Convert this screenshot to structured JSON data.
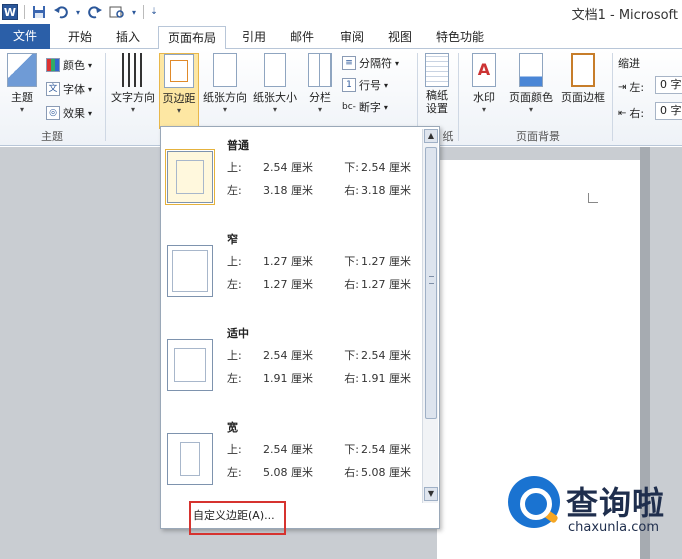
{
  "window": {
    "title": "文档1 - Microsoft"
  },
  "quick_access": {
    "app_icon": "W",
    "icons": [
      "save-icon",
      "undo-icon",
      "redo-icon",
      "customize-icon"
    ]
  },
  "tabs": [
    {
      "label": "文件",
      "active": false
    },
    {
      "label": "开始",
      "active": false
    },
    {
      "label": "插入",
      "active": false
    },
    {
      "label": "页面布局",
      "active": true
    },
    {
      "label": "引用",
      "active": false
    },
    {
      "label": "邮件",
      "active": false
    },
    {
      "label": "审阅",
      "active": false
    },
    {
      "label": "视图",
      "active": false
    },
    {
      "label": "特色功能",
      "active": false
    }
  ],
  "ribbon": {
    "theme_group": {
      "label": "主题",
      "themes_button": "主题",
      "colors": "颜色",
      "fonts": "字体",
      "effects": "效果"
    },
    "page_setup": {
      "text_direction": "文字方向",
      "margins": "页边距",
      "orientation": "纸张方向",
      "size": "纸张大小",
      "columns": "分栏",
      "breaks": "分隔符",
      "line_numbers": "行号",
      "hyphenation": "断字"
    },
    "draft": {
      "button": "稿纸\n设置",
      "label": "纸"
    },
    "page_background": {
      "label": "页面背景",
      "watermark": "水印",
      "page_color": "页面颜色",
      "page_borders": "页面边框"
    },
    "paragraph": {
      "indent_label": "缩进",
      "left": "左:",
      "right": "右:",
      "left_value": "0 字",
      "right_value": "0 字"
    }
  },
  "margins_menu": {
    "presets": [
      {
        "name": "普通",
        "top_label": "上:",
        "top": "2.54 厘米",
        "bottom_label": "下:",
        "bottom": "2.54 厘米",
        "left_label": "左:",
        "left": "3.18 厘米",
        "right_label": "右:",
        "right": "3.18 厘米",
        "selected": true
      },
      {
        "name": "窄",
        "top_label": "上:",
        "top": "1.27 厘米",
        "bottom_label": "下:",
        "bottom": "1.27 厘米",
        "left_label": "左:",
        "left": "1.27 厘米",
        "right_label": "右:",
        "right": "1.27 厘米",
        "selected": false
      },
      {
        "name": "适中",
        "top_label": "上:",
        "top": "2.54 厘米",
        "bottom_label": "下:",
        "bottom": "2.54 厘米",
        "left_label": "左:",
        "left": "1.91 厘米",
        "right_label": "右:",
        "right": "1.91 厘米",
        "selected": false
      },
      {
        "name": "宽",
        "top_label": "上:",
        "top": "2.54 厘米",
        "bottom_label": "下:",
        "bottom": "2.54 厘米",
        "left_label": "左:",
        "left": "5.08 厘米",
        "right_label": "右:",
        "right": "5.08 厘米",
        "selected": false
      }
    ],
    "custom_margins": "自定义边距(A)..."
  },
  "watermark_brand": {
    "name": "查询啦",
    "url": "chaxunla.com"
  },
  "colors": {
    "file_tab": "#2b5fa8",
    "highlight_box": "#d6332f",
    "selected_button": "#fde7a3"
  }
}
